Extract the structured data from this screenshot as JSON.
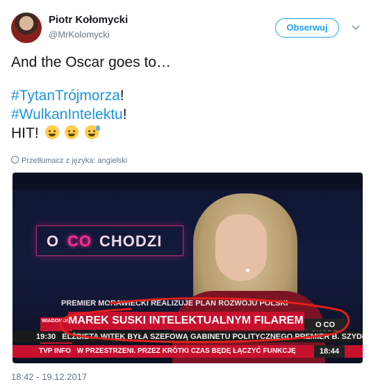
{
  "user": {
    "name": "Piotr Kołomycki",
    "handle": "@MrKolomycki"
  },
  "follow_label": "Obserwuj",
  "tweet": {
    "line1": "And the Oscar goes to…",
    "hashtag1": "#TytanTrójmorza",
    "exclaim1": "!",
    "hashtag2": "#WulkanIntelektu",
    "exclaim2": "!",
    "hit": "HIT!",
    "emojis": [
      "crying-face-emoji",
      "tears-of-joy-emoji",
      "sweat-smile-emoji"
    ]
  },
  "translate_label": "Przetłumacz z języka: angielski",
  "media": {
    "sign_o": "O",
    "sign_co": "CO",
    "sign_chodzi": "CHODZI",
    "ticker_top": "PREMIER MORAWIECKI REALIZUJE PLAN ROZWOJU POLSKI",
    "ticker_main": "MAREK SUSKI INTELEKTUALNYM FILAREM RZĄDU",
    "ticker_sub_time": "19:30",
    "ticker_sub": "ELŻBIETA WITEK BYŁA SZEFOWĄ GABINETU POLITYCZNEGO PREMIER B. SZYDŁO",
    "ticker_bottom": "TVP INFO",
    "ticker_bottom_text": "W PRZESTRZENI. PRZEZ KRÓTKI CZAS BĘDĘ ŁĄCZYĆ FUNKCJĘ",
    "clock": "18:44",
    "channel_box": "WIADOMOŚCI",
    "side_logo": "O CO CHODZI",
    "colors": {
      "ticker_red": "#c8102e",
      "annotation_red": "#e0201b"
    }
  },
  "timestamp": "18:42 - 19.12.2017"
}
